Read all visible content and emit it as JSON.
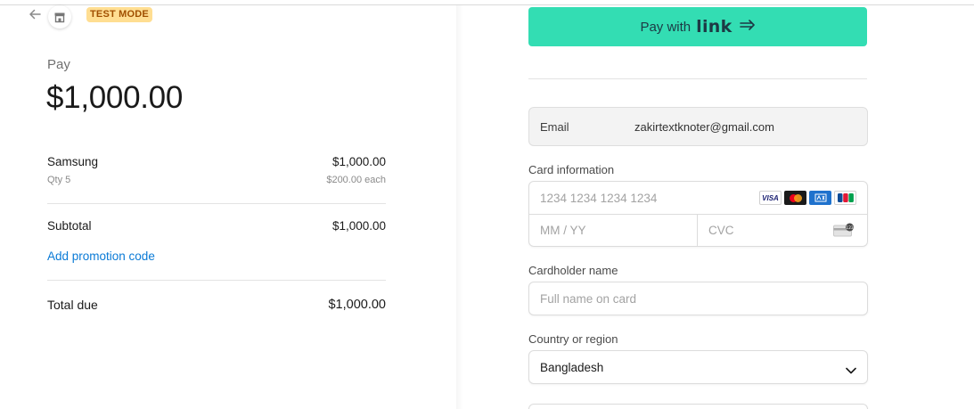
{
  "header": {
    "badge": "TEST MODE",
    "icons": {
      "back": "back-arrow-icon",
      "store": "store-icon"
    }
  },
  "summary": {
    "pay_label": "Pay",
    "amount": "$1,000.00",
    "item": {
      "name": "Samsung",
      "price": "$1,000.00",
      "qty": "Qty 5",
      "each": "$200.00 each"
    },
    "subtotal_label": "Subtotal",
    "subtotal_value": "$1,000.00",
    "promo_link": "Add promotion code",
    "total_label": "Total due",
    "total_value": "$1,000.00"
  },
  "payment": {
    "link_button": {
      "text": "Pay with",
      "brand": "link",
      "accent": "#33ddb3"
    },
    "email": {
      "label": "Email",
      "value": "zakirtextknoter@gmail.com"
    },
    "card": {
      "label": "Card information",
      "number_placeholder": "1234 1234 1234 1234",
      "expiry_placeholder": "MM / YY",
      "cvc_placeholder": "CVC",
      "brands": [
        "visa",
        "mastercard",
        "amex",
        "jcb"
      ]
    },
    "cardholder": {
      "label": "Cardholder name",
      "placeholder": "Full name on card"
    },
    "country": {
      "label": "Country or region",
      "value": "Bangladesh"
    }
  },
  "colors": {
    "link_text": "#0a7ad6",
    "badge_bg": "#ffde92",
    "badge_text": "#a04f00"
  }
}
